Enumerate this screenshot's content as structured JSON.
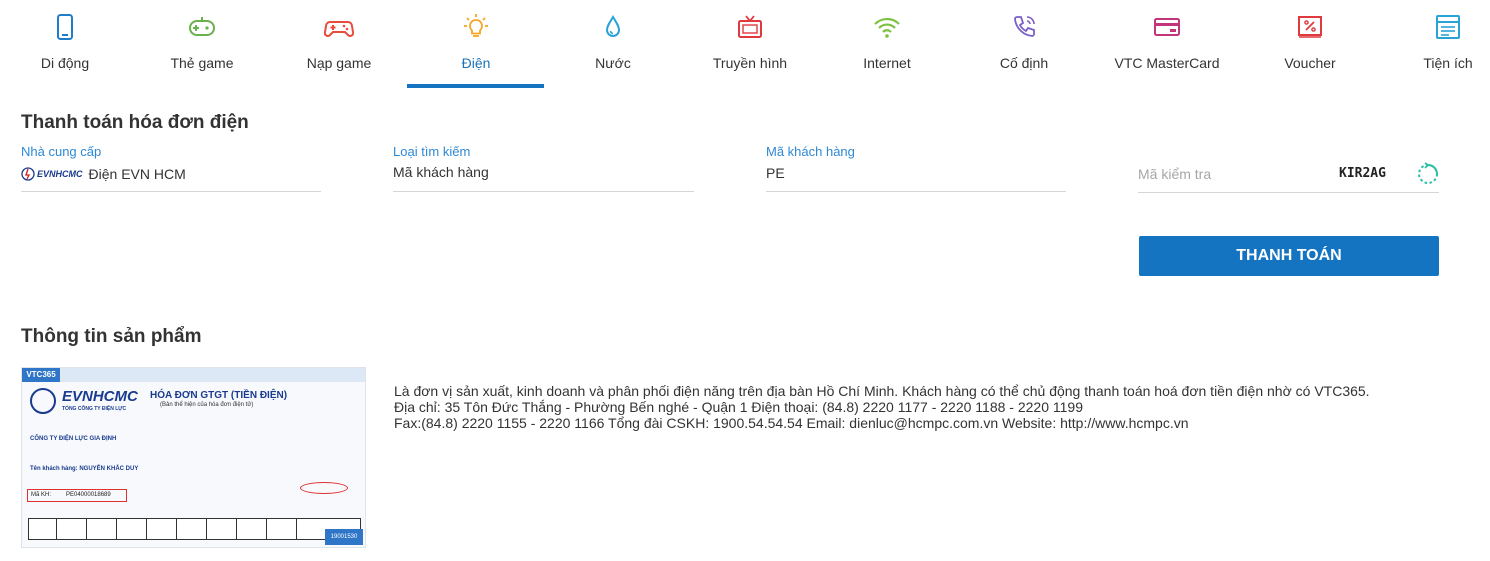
{
  "nav": {
    "items": [
      {
        "label": "Di động",
        "icon": "mobile-phone-icon",
        "color": "#1f7dc8"
      },
      {
        "label": "Thẻ game",
        "icon": "game-card-icon",
        "color": "#6ab04c"
      },
      {
        "label": "Nạp game",
        "icon": "gamepad-icon",
        "color": "#e74c3c"
      },
      {
        "label": "Điện",
        "icon": "lightbulb-icon",
        "color": "#f5a623",
        "active": true
      },
      {
        "label": "Nước",
        "icon": "water-drop-icon",
        "color": "#29a3d6"
      },
      {
        "label": "Truyền hình",
        "icon": "tv-icon",
        "color": "#e0393e"
      },
      {
        "label": "Internet",
        "icon": "wifi-icon",
        "color": "#7cc142"
      },
      {
        "label": "Cố định",
        "icon": "phone-icon",
        "color": "#7a5fc7"
      },
      {
        "label": "VTC MasterCard",
        "icon": "credit-card-icon",
        "color": "#c2357d"
      },
      {
        "label": "Voucher",
        "icon": "voucher-icon",
        "color": "#e0393e"
      },
      {
        "label": "Tiện ích",
        "icon": "utility-icon",
        "color": "#29a3d6"
      }
    ],
    "accent_color": "#1574c1"
  },
  "form": {
    "title": "Thanh toán hóa đơn điện",
    "provider": {
      "label": "Nhà cung cấp",
      "value": "Điện EVN HCM",
      "logo_text": "EVNHCMC"
    },
    "search_type": {
      "label": "Loại tìm kiếm",
      "value": "Mã khách hàng"
    },
    "customer_code": {
      "label": "Mã khách hàng",
      "value": "PE"
    },
    "captcha": {
      "placeholder": "Mã kiểm tra",
      "code": "KIR2AG"
    },
    "pay_button": "THANH TOÁN"
  },
  "product": {
    "title": "Thông tin sản phẩm",
    "bill_image": {
      "vtc": "VTC365",
      "brand": "EVNHCMC",
      "heading": "HÓA ĐƠN GTGT (TIỀN ĐIỆN)",
      "subheading": "(Bản thể hiện của hóa đơn điện tử)",
      "company": "CÔNG TY ĐIỆN LỰC GIA ĐỊNH",
      "customer_name": "Tên khách hàng: NGUYỄN KHẮC DUY",
      "customer_code_label": "Mã KH:",
      "customer_code": "PE04000018689",
      "hotline": "19001530"
    },
    "description": [
      "Là đơn vị sản xuất, kinh doanh và phân phối điện năng trên địa bàn Hồ Chí Minh. Khách hàng có thể chủ động thanh toán hoá đơn tiền điện nhờ có VTC365.",
      "Địa chỉ: 35 Tôn Đức Thắng - Phường Bến nghé - Quận 1 Điện thoại: (84.8) 2220 1177 - 2220 1188 - 2220 1199",
      "Fax:(84.8) 2220 1155 - 2220 1166 Tổng đài CSKH: 1900.54.54.54 Email: dienluc@hcmpc.com.vn Website: http://www.hcmpc.vn"
    ]
  }
}
